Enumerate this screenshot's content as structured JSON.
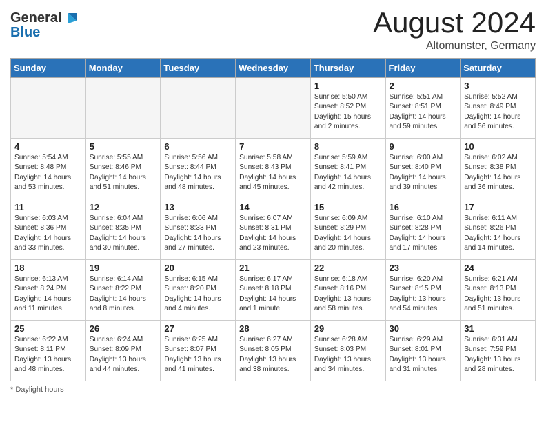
{
  "header": {
    "logo_general": "General",
    "logo_blue": "Blue",
    "month_title": "August 2024",
    "subtitle": "Altomunster, Germany"
  },
  "days_of_week": [
    "Sunday",
    "Monday",
    "Tuesday",
    "Wednesday",
    "Thursday",
    "Friday",
    "Saturday"
  ],
  "weeks": [
    [
      {
        "day": "",
        "info": ""
      },
      {
        "day": "",
        "info": ""
      },
      {
        "day": "",
        "info": ""
      },
      {
        "day": "",
        "info": ""
      },
      {
        "day": "1",
        "info": "Sunrise: 5:50 AM\nSunset: 8:52 PM\nDaylight: 15 hours\nand 2 minutes."
      },
      {
        "day": "2",
        "info": "Sunrise: 5:51 AM\nSunset: 8:51 PM\nDaylight: 14 hours\nand 59 minutes."
      },
      {
        "day": "3",
        "info": "Sunrise: 5:52 AM\nSunset: 8:49 PM\nDaylight: 14 hours\nand 56 minutes."
      }
    ],
    [
      {
        "day": "4",
        "info": "Sunrise: 5:54 AM\nSunset: 8:48 PM\nDaylight: 14 hours\nand 53 minutes."
      },
      {
        "day": "5",
        "info": "Sunrise: 5:55 AM\nSunset: 8:46 PM\nDaylight: 14 hours\nand 51 minutes."
      },
      {
        "day": "6",
        "info": "Sunrise: 5:56 AM\nSunset: 8:44 PM\nDaylight: 14 hours\nand 48 minutes."
      },
      {
        "day": "7",
        "info": "Sunrise: 5:58 AM\nSunset: 8:43 PM\nDaylight: 14 hours\nand 45 minutes."
      },
      {
        "day": "8",
        "info": "Sunrise: 5:59 AM\nSunset: 8:41 PM\nDaylight: 14 hours\nand 42 minutes."
      },
      {
        "day": "9",
        "info": "Sunrise: 6:00 AM\nSunset: 8:40 PM\nDaylight: 14 hours\nand 39 minutes."
      },
      {
        "day": "10",
        "info": "Sunrise: 6:02 AM\nSunset: 8:38 PM\nDaylight: 14 hours\nand 36 minutes."
      }
    ],
    [
      {
        "day": "11",
        "info": "Sunrise: 6:03 AM\nSunset: 8:36 PM\nDaylight: 14 hours\nand 33 minutes."
      },
      {
        "day": "12",
        "info": "Sunrise: 6:04 AM\nSunset: 8:35 PM\nDaylight: 14 hours\nand 30 minutes."
      },
      {
        "day": "13",
        "info": "Sunrise: 6:06 AM\nSunset: 8:33 PM\nDaylight: 14 hours\nand 27 minutes."
      },
      {
        "day": "14",
        "info": "Sunrise: 6:07 AM\nSunset: 8:31 PM\nDaylight: 14 hours\nand 23 minutes."
      },
      {
        "day": "15",
        "info": "Sunrise: 6:09 AM\nSunset: 8:29 PM\nDaylight: 14 hours\nand 20 minutes."
      },
      {
        "day": "16",
        "info": "Sunrise: 6:10 AM\nSunset: 8:28 PM\nDaylight: 14 hours\nand 17 minutes."
      },
      {
        "day": "17",
        "info": "Sunrise: 6:11 AM\nSunset: 8:26 PM\nDaylight: 14 hours\nand 14 minutes."
      }
    ],
    [
      {
        "day": "18",
        "info": "Sunrise: 6:13 AM\nSunset: 8:24 PM\nDaylight: 14 hours\nand 11 minutes."
      },
      {
        "day": "19",
        "info": "Sunrise: 6:14 AM\nSunset: 8:22 PM\nDaylight: 14 hours\nand 8 minutes."
      },
      {
        "day": "20",
        "info": "Sunrise: 6:15 AM\nSunset: 8:20 PM\nDaylight: 14 hours\nand 4 minutes."
      },
      {
        "day": "21",
        "info": "Sunrise: 6:17 AM\nSunset: 8:18 PM\nDaylight: 14 hours\nand 1 minute."
      },
      {
        "day": "22",
        "info": "Sunrise: 6:18 AM\nSunset: 8:16 PM\nDaylight: 13 hours\nand 58 minutes."
      },
      {
        "day": "23",
        "info": "Sunrise: 6:20 AM\nSunset: 8:15 PM\nDaylight: 13 hours\nand 54 minutes."
      },
      {
        "day": "24",
        "info": "Sunrise: 6:21 AM\nSunset: 8:13 PM\nDaylight: 13 hours\nand 51 minutes."
      }
    ],
    [
      {
        "day": "25",
        "info": "Sunrise: 6:22 AM\nSunset: 8:11 PM\nDaylight: 13 hours\nand 48 minutes."
      },
      {
        "day": "26",
        "info": "Sunrise: 6:24 AM\nSunset: 8:09 PM\nDaylight: 13 hours\nand 44 minutes."
      },
      {
        "day": "27",
        "info": "Sunrise: 6:25 AM\nSunset: 8:07 PM\nDaylight: 13 hours\nand 41 minutes."
      },
      {
        "day": "28",
        "info": "Sunrise: 6:27 AM\nSunset: 8:05 PM\nDaylight: 13 hours\nand 38 minutes."
      },
      {
        "day": "29",
        "info": "Sunrise: 6:28 AM\nSunset: 8:03 PM\nDaylight: 13 hours\nand 34 minutes."
      },
      {
        "day": "30",
        "info": "Sunrise: 6:29 AM\nSunset: 8:01 PM\nDaylight: 13 hours\nand 31 minutes."
      },
      {
        "day": "31",
        "info": "Sunrise: 6:31 AM\nSunset: 7:59 PM\nDaylight: 13 hours\nand 28 minutes."
      }
    ]
  ],
  "footer": {
    "note": "Daylight hours"
  }
}
